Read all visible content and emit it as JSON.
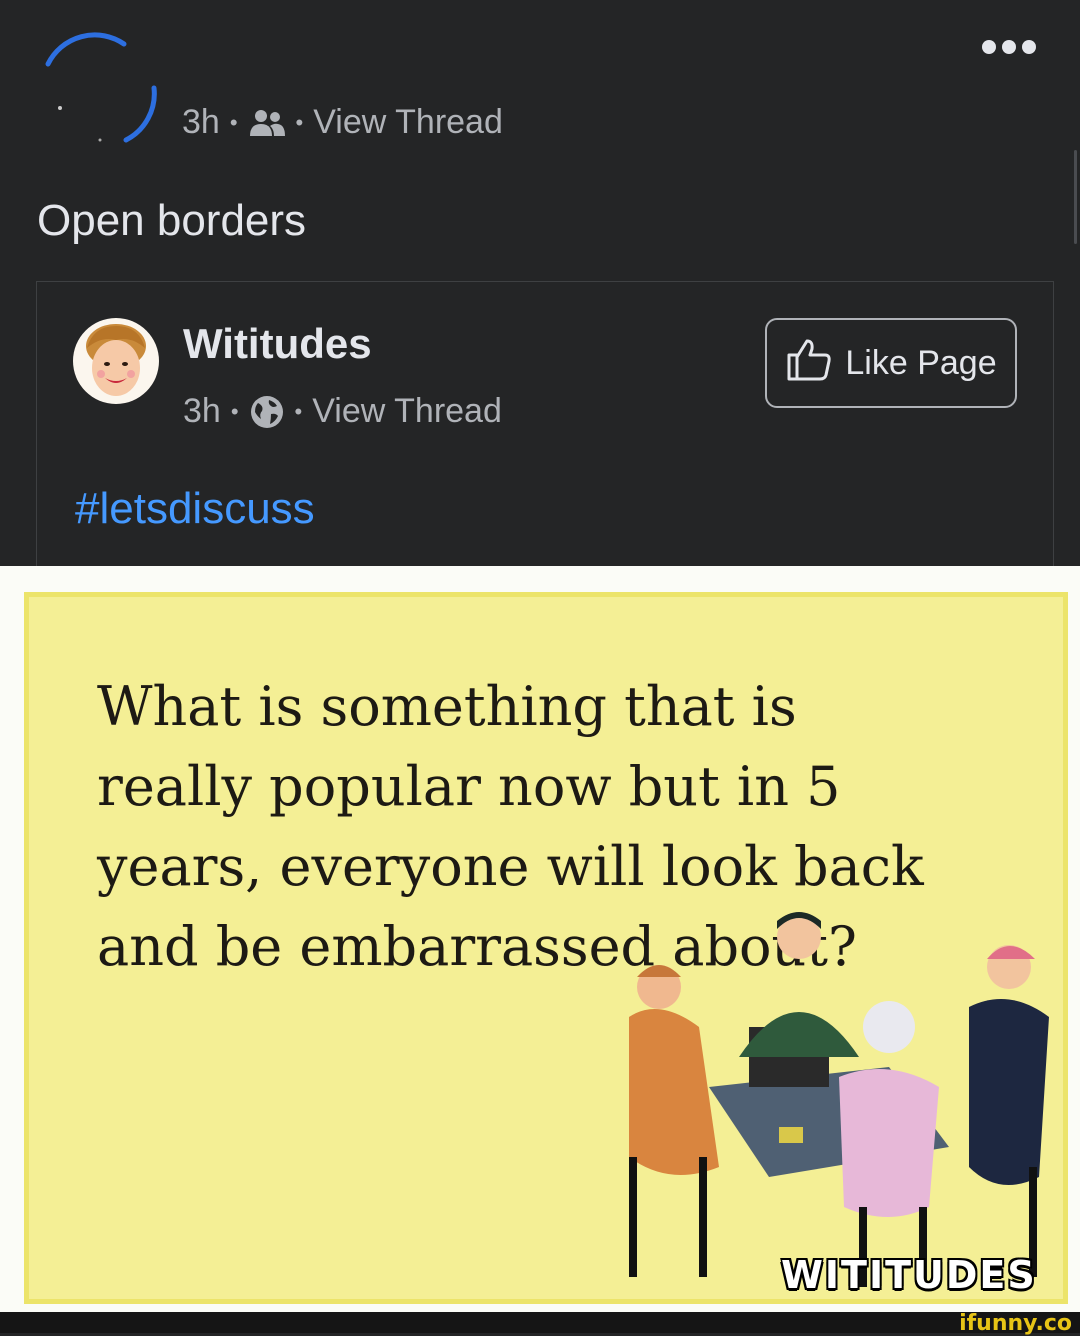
{
  "post": {
    "time": "3h",
    "separator": "•",
    "audience_icon": "friends-icon",
    "view_thread": "View Thread",
    "caption": "Open borders"
  },
  "shared": {
    "page_name": "Wititudes",
    "time": "3h",
    "separator": "•",
    "audience_icon": "globe-icon",
    "view_thread": "View Thread",
    "like_button": "Like Page",
    "hashtag": "#letsdiscuss"
  },
  "ecard": {
    "text": "What is something that is really popular now but in 5 years, everyone will look back and be embarrassed about?",
    "brand": "WITITUDES"
  },
  "watermark": "ifunny.co",
  "colors": {
    "background": "#242526",
    "link_blue": "#4599ff",
    "ecard_yellow": "#f4ef95"
  }
}
